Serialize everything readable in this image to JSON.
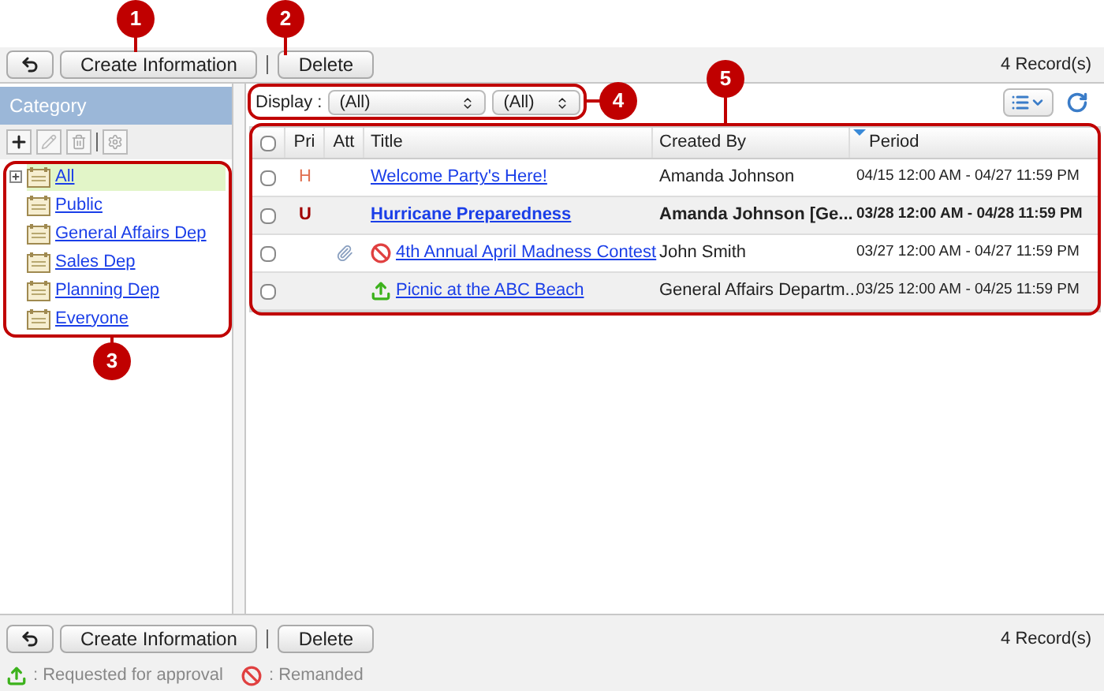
{
  "toolbar": {
    "buttons": [
      "Create Information",
      "Delete"
    ],
    "record_count": "4 Record(s)"
  },
  "category": {
    "title": "Category",
    "items": [
      {
        "label": "All",
        "selected": true,
        "expandable": true
      },
      {
        "label": "Public",
        "selected": false,
        "expandable": false
      },
      {
        "label": "General Affairs Dep",
        "selected": false,
        "expandable": false
      },
      {
        "label": "Sales Dep",
        "selected": false,
        "expandable": false
      },
      {
        "label": "Planning Dep",
        "selected": false,
        "expandable": false
      },
      {
        "label": "Everyone",
        "selected": false,
        "expandable": false
      }
    ]
  },
  "filter": {
    "label": "Display :",
    "selects": [
      "(All)",
      "(All)"
    ]
  },
  "table": {
    "all_checked": false,
    "columns": [
      {
        "label": "Pri",
        "sorted": false
      },
      {
        "label": "Att",
        "sorted": false
      },
      {
        "label": "Title",
        "sorted": false
      },
      {
        "label": "Created By",
        "sorted": false
      },
      {
        "label": "Period",
        "sorted": true
      }
    ],
    "rows": [
      {
        "checked": false,
        "priority": "H",
        "urgent": false,
        "attachment": false,
        "remanded": false,
        "requested_approval": false,
        "title": "Welcome Party's Here!",
        "created_by": "Amanda Johnson",
        "period": "04/15 12:00 AM - 04/27 11:59 PM",
        "unread": false
      },
      {
        "checked": false,
        "priority": "U",
        "urgent": true,
        "attachment": false,
        "remanded": false,
        "requested_approval": false,
        "title": "Hurricane Preparedness",
        "created_by": "Amanda Johnson [Ge...",
        "period": "03/28 12:00 AM - 04/28 11:59 PM",
        "unread": true
      },
      {
        "checked": false,
        "attachment": true,
        "remanded": true,
        "requested_approval": false,
        "title": "4th Annual April Madness Contest",
        "created_by": "John Smith",
        "period": "03/27 12:00 AM - 04/27 11:59 PM",
        "unread": false
      },
      {
        "checked": false,
        "attachment": false,
        "remanded": false,
        "requested_approval": true,
        "title": "Picnic at the ABC Beach",
        "created_by": "General Affairs Departm...",
        "period": "03/25 12:00 AM - 04/25 11:59 PM",
        "unread": false
      }
    ]
  },
  "bottom_toolbar": {
    "buttons": [
      "Create Information",
      "Delete"
    ],
    "record_count": "4 Record(s)"
  },
  "legend": [
    ": Requested for approval",
    ": Remanded"
  ],
  "callouts": [
    "1",
    "2",
    "3",
    "4",
    "5"
  ]
}
